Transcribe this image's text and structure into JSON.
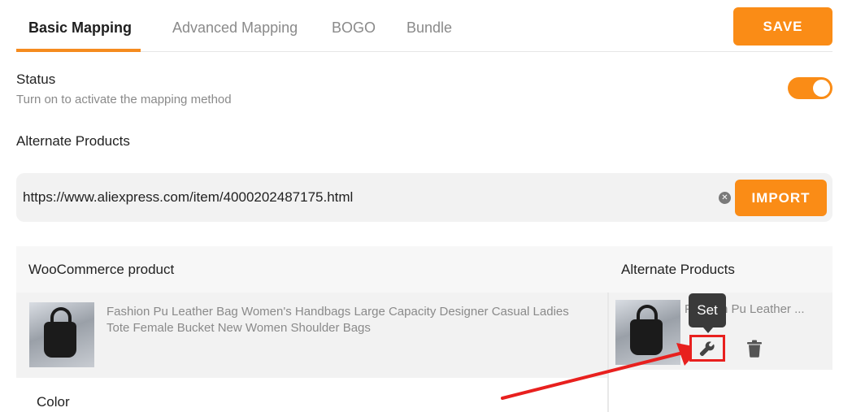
{
  "tabs": [
    {
      "label": "Basic Mapping",
      "active": true
    },
    {
      "label": "Advanced Mapping",
      "active": false
    },
    {
      "label": "BOGO",
      "active": false
    },
    {
      "label": "Bundle",
      "active": false
    }
  ],
  "save_label": "SAVE",
  "status": {
    "title": "Status",
    "subtitle": "Turn on to activate the mapping method",
    "enabled": true
  },
  "alternate": {
    "title": "Alternate Products",
    "url_value": "https://www.aliexpress.com/item/4000202487175.html",
    "clear_icon": "close-circle-icon",
    "import_label": "IMPORT"
  },
  "table": {
    "col_woo": "WooCommerce product",
    "col_alt": "Alternate Products",
    "row": {
      "woo_name": "Fashion Pu Leather Bag Women's Handbags Large Capacity Designer Casual Ladies Tote Female Bucket New Women Shoulder Bags",
      "alt_name": "Fashion Pu Leather ...",
      "set_icon": "wrench-icon",
      "delete_icon": "trash-icon",
      "tooltip": "Set"
    },
    "attribute_label": "Color"
  },
  "colors": {
    "accent": "#fa8c16",
    "highlight": "#e8201e"
  }
}
